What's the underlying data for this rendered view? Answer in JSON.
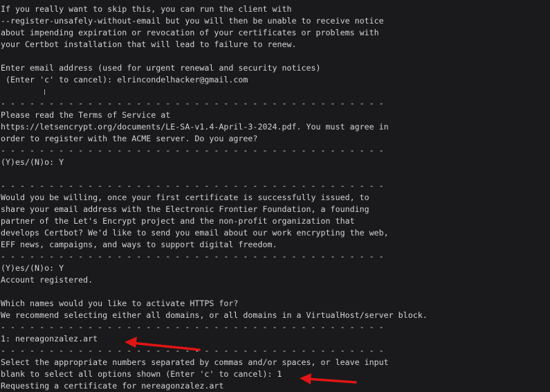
{
  "terminal": {
    "lines": [
      "If you really want to skip this, you can run the client with",
      "--register-unsafely-without-email but you will then be unable to receive notice",
      "about impending expiration or revocation of your certificates or problems with",
      "your Certbot installation that will lead to failure to renew.",
      "",
      "Enter email address (used for urgent renewal and security notices)",
      " (Enter 'c' to cancel): elrincondelhacker@gmail.com",
      "",
      "- - - - - - - - - - - - - - - - - - - - - - - - - - - - - - - - - - - - - - - -",
      "Please read the Terms of Service at",
      "https://letsencrypt.org/documents/LE-SA-v1.4-April-3-2024.pdf. You must agree in",
      "order to register with the ACME server. Do you agree?",
      "- - - - - - - - - - - - - - - - - - - - - - - - - - - - - - - - - - - - - - - -",
      "(Y)es/(N)o: Y",
      "",
      "- - - - - - - - - - - - - - - - - - - - - - - - - - - - - - - - - - - - - - - -",
      "Would you be willing, once your first certificate is successfully issued, to",
      "share your email address with the Electronic Frontier Foundation, a founding",
      "partner of the Let's Encrypt project and the non-profit organization that",
      "develops Certbot? We'd like to send you email about our work encrypting the web,",
      "EFF news, campaigns, and ways to support digital freedom.",
      "- - - - - - - - - - - - - - - - - - - - - - - - - - - - - - - - - - - - - - - -",
      "(Y)es/(N)o: Y",
      "Account registered.",
      "",
      "Which names would you like to activate HTTPS for?",
      "We recommend selecting either all domains, or all domains in a VirtualHost/server block.",
      "- - - - - - - - - - - - - - - - - - - - - - - - - - - - - - - - - - - - - - - -",
      "1: nereagonzalez.art",
      "- - - - - - - - - - - - - - - - - - - - - - - - - - - - - - - - - - - - - - - -",
      "Select the appropriate numbers separated by commas and/or spaces, or leave input",
      "blank to select all options shown (Enter 'c' to cancel): 1",
      "Requesting a certificate for nereagonzalez.art"
    ]
  },
  "annotations": {
    "arrow_color": "#e01515"
  }
}
